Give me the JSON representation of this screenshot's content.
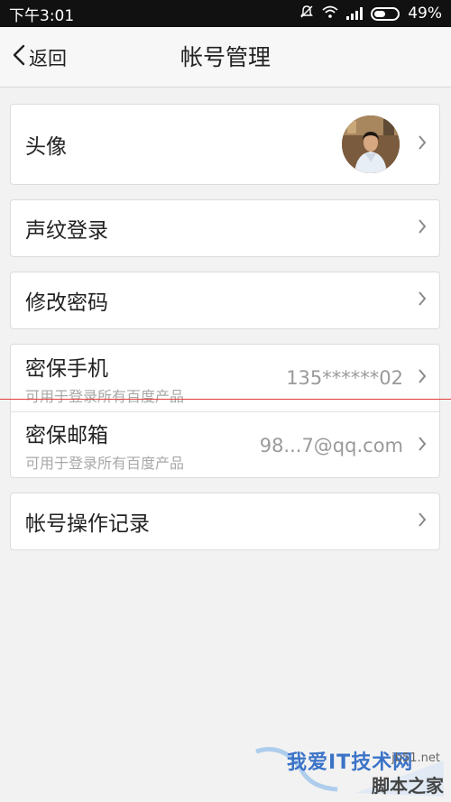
{
  "status_bar": {
    "time": "下午3:01",
    "battery": "49%",
    "battery_level": 0.49,
    "icons": [
      "mute-icon",
      "wifi-icon",
      "signal-icon",
      "battery-icon"
    ]
  },
  "header": {
    "back_label": "返回",
    "title": "帐号管理"
  },
  "rows": {
    "avatar": {
      "label": "头像"
    },
    "voiceprint": {
      "label": "声纹登录"
    },
    "password": {
      "label": "修改密码"
    },
    "phone": {
      "label": "密保手机",
      "sub": "可用于登录所有百度产品",
      "value": "135******02"
    },
    "email": {
      "label": "密保邮箱",
      "sub": "可用于登录所有百度产品",
      "value": "98...7@qq.com"
    },
    "records": {
      "label": "帐号操作记录"
    }
  },
  "watermark": {
    "brand": "我爱IT技术网",
    "url": "jb51.net",
    "site": "脚本之家"
  },
  "colors": {
    "background": "#f2f2f2",
    "status_bar": "#111111",
    "card": "#ffffff",
    "secondary_text": "#9a9a9a",
    "annotation_line": "#e23b3b"
  }
}
